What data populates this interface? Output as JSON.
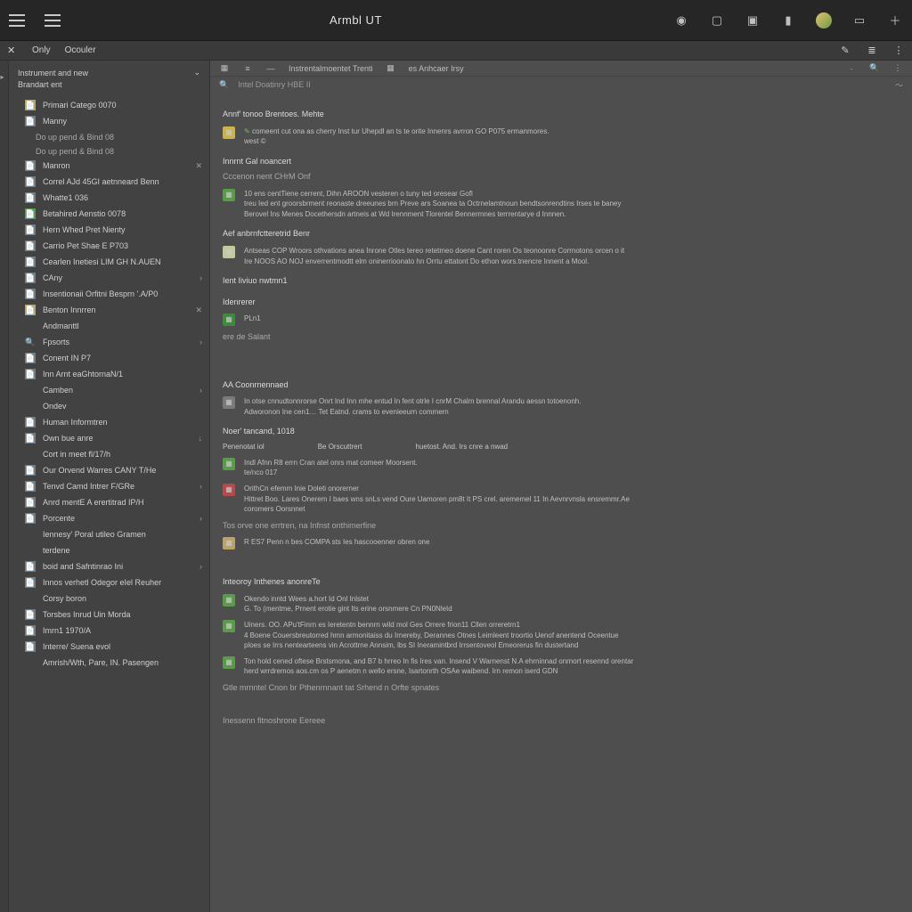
{
  "titlebar": {
    "title": "Armbl UT"
  },
  "tabs": {
    "back_glyph": "✕",
    "tab1": "Only",
    "tab2": "Ocouler"
  },
  "sidebar": {
    "header_line1": "Instrument and new",
    "header_line2": "Brandart ent",
    "sections": [
      {
        "title": "",
        "items": [
          {
            "icon": "📄",
            "color": "ic-tan",
            "label": "Primari Catego 0070"
          },
          {
            "icon": "📄",
            "color": "ic-gry",
            "label": "Manny"
          }
        ]
      },
      {
        "title": "Do up pend & Bind 08",
        "items": [
          {
            "icon": "📄",
            "color": "ic-gry",
            "label": "Manron",
            "trail": "✕"
          },
          {
            "icon": "📄",
            "color": "ic-gry",
            "label": "Correl AJd 45GI aetnneard Benn"
          },
          {
            "icon": "📄",
            "color": "ic-gry",
            "label": "Whatte1 036"
          },
          {
            "icon": "📄",
            "color": "ic-grn",
            "label": "Betahired Aenstio 0078"
          },
          {
            "icon": "📄",
            "color": "ic-gry",
            "label": "Hern Whed Pret Nienty"
          },
          {
            "icon": "📄",
            "color": "ic-gry",
            "label": "Carrio Pet Shae E P703"
          },
          {
            "icon": "📄",
            "color": "ic-gry",
            "label": "Cearlen Inetiesi LIM GH N.AUEN"
          },
          {
            "icon": "📄",
            "color": "ic-gry",
            "label": "CAny",
            "chev": "›"
          },
          {
            "icon": "📄",
            "color": "ic-gry",
            "label": "Insentionaii Orfitni Besprn '.A/P0"
          },
          {
            "icon": "📄",
            "color": "ic-tan",
            "label": "Benton Innrren",
            "trail": "✕"
          },
          {
            "icon": "",
            "color": "",
            "label": "Andmanttl"
          },
          {
            "icon": "🔍",
            "color": "",
            "label": "Fpsorts",
            "chev": "›"
          },
          {
            "icon": "📄",
            "color": "ic-gry",
            "label": "Conent IN P7"
          },
          {
            "icon": "📄",
            "color": "ic-gry",
            "label": "Inn Arnt eaGhtornaN/1"
          },
          {
            "icon": "",
            "color": "",
            "label": "Camben",
            "chev": "›"
          },
          {
            "icon": "",
            "color": "",
            "label": "Ondev"
          },
          {
            "icon": "📄",
            "color": "ic-gry",
            "label": "Human Informtren"
          },
          {
            "icon": "📄",
            "color": "ic-gry",
            "label": "Own bue anre",
            "trail": "↓"
          },
          {
            "icon": "",
            "color": "",
            "label": "Cort in meet fl/17/h"
          },
          {
            "icon": "📄",
            "color": "ic-gry",
            "label": "Our Orvend Warres CANY T/He"
          },
          {
            "icon": "📄",
            "color": "ic-gry",
            "label": "Tenvd Camd Intrer F/GRe",
            "chev": "›"
          },
          {
            "icon": "📄",
            "color": "ic-gry",
            "label": "Anrd mentE A erertitrad IP/H"
          },
          {
            "icon": "📄",
            "color": "ic-gry",
            "label": "Porcente",
            "chev": "›"
          },
          {
            "icon": "",
            "color": "",
            "label": "Iennesy' Poral utileo Gramen"
          },
          {
            "icon": "",
            "color": "",
            "label": "terdene"
          },
          {
            "icon": "📄",
            "color": "ic-gry",
            "label": "boid and Safntinrao Ini",
            "chev": "›"
          },
          {
            "icon": "📄",
            "color": "ic-gry",
            "label": "Innos verhetl Odegor eIel Reuher"
          },
          {
            "icon": "",
            "color": "",
            "label": "Corsy boron"
          },
          {
            "icon": "📄",
            "color": "ic-gry",
            "label": "Torsbes Inrud Uin Morda"
          },
          {
            "icon": "📄",
            "color": "ic-gry",
            "label": "Imrn1 1970/A"
          },
          {
            "icon": "📄",
            "color": "ic-gry",
            "label": "Interre/ Suena evol"
          },
          {
            "icon": "",
            "color": "",
            "label": "Amrish/Wth, Pare, IN. Pasengen"
          }
        ]
      }
    ]
  },
  "toolbar": {
    "items": [
      "▦",
      "≡",
      "—",
      "Instrentalmoentet Trenti",
      "▦",
      "es Anhcaer Irsy"
    ]
  },
  "searchbar": {
    "left_icon": "🔍",
    "text": "Intel Doatinry HBE II"
  },
  "doc": {
    "h1": "Annf' tonoo Brentoes. Mehte",
    "block1_icon": "▦",
    "block1_lines": [
      "comeent cut ona as cherry Inst tur Uhepdl  an ts te orite Innenrs avrron GO P075  ermanmores.",
      "west ©"
    ],
    "h2": "Innrnt Gal noancert",
    "sub2": "Cccenon nent  CHrM Onf",
    "block2_icon": "▦",
    "block2_lines": [
      "10 ens centTiene cerrent, Dihn AROON vesteren o tuny ted oresear Gofl",
      "treu Ied ent groorsbrment reonaste dreeunes brn Preve ars Soanea ta Octrnelamtnoun bendtsonrendtins Irses te baney",
      "Berovel Ins Menes Docethersdn artneis at Wd Irennment  Tlorentel Bennermnes terrrentarye d Innnen."
    ],
    "h3": "Aef anbrnfctteretrid Benr",
    "block3_icon": "▦",
    "block3_color": "ic-pale",
    "block3_lines": [
      "Antseas COP Wroors  othvations anea Inrone Otles tereo retetmeo doene Cant roren Os teonoonre Corrnotons orcen o it",
      "Ire NOOS AO NOJ enverrentmodtt  elm oninerrioonato hn Orrtu ettatont  Do ethon wors.tnencre Innent a Mool."
    ],
    "h4": "Ient Iiviuo nwtmn1",
    "h5": "Idenrerer",
    "inline1_icon": "▦",
    "inline1_color": "ic-grn2",
    "inline1_label": "PLn1",
    "inline2_label": "ere de Salant",
    "h6": "AA Coonrnennaed",
    "block4_icon": "▦",
    "block4_color": "ic-gry",
    "block4_lines": [
      "In otse cnnudtonnrorse Onrt Ind Inn mhe entud  In fent otrle I cnrM Chalm brennal Arandu aessn totoenonh.",
      "Adworonon Ine cen1…                                                                             Tet Eatnd. crams to evenieeurn commern"
    ],
    "h7": "Noer' tancand, 1018",
    "row3": {
      "c1": "Penenotat iol",
      "c2": "Be Orscuttrert",
      "c3": "huetost. And. Irs cnre  a nwad"
    },
    "block5_icon": "▦",
    "block5_color": "ic-grn",
    "block5_lines": [
      "Indl  Afnn R8 errn Cran atel onrs mat comeer  Moorsent.",
      "te/nco 017"
    ],
    "block6_icon": "▦",
    "block6_color": "ic-red",
    "block6_lines": [
      "OrithCn efemm Inie Doleti onorerner",
      "Hittret Boo. Lares Onerem I baes wns snLs vend Oure Uamoren pm8t It PS crel. arememel 11 In Aevnrvnsla ensremmr.Ae",
      "coromers  Oorsnnet"
    ],
    "line_a": "Tos orve one errtren, na Infnst  onthimerfine",
    "block7_icon": "▦",
    "block7_color": "ic-tan",
    "block7_line": "R ES7 Penn n bes COMPA sts Ies hascooenner obren one",
    "h8": "Inteoroy Inthenes anonreTe",
    "block8_icon": "▦",
    "block8_color": "ic-grn",
    "block8_lines": [
      "Okendo inntd Wees  a.hort Id Onl Inlstet",
      "G. To (mentme, Prnent erotie gint Its erine  orsnmere Cn PN0NleId"
    ],
    "block9_icon": "▦",
    "block9_color": "ic-grn",
    "block9_lines": [
      "Uiners. OO. APu'tFinrn es Ieretentn bennrn wild mol Ges Orrere frion11 Cllen orreretrn1",
      "4 Boene Couersbreutorred hmn armonitaiss du Irnereby, Derannes Otnes Leimleent troortio Uenof anentend Oceentue",
      "ploes se Irrs nentearteens vin Acrottrne Annsim, lbs SI Ineramintbrd Irrsentoveol Emeorerus fin dustertand"
    ],
    "block10_icon": "▦",
    "block10_color": "ic-grn",
    "block10_lines": [
      "Ton hold cened oftese Brstsmona, and B7 b hrreo In fis Ires van. Insend V Warnenst N.A   ehrninnad onrnort resennd  orentar",
      "herd wrrdremos aos.cm os P aenetm n  wello ersne, Isartonrth OSAe  waibend. Irn remon iserd GDN"
    ],
    "line_b": "Gtle mrnntel  Cnon br Pthenrnnant tat Srhend n Orfte  spnates",
    "line_c": "Inessenn fitnoshrone Eereee"
  }
}
